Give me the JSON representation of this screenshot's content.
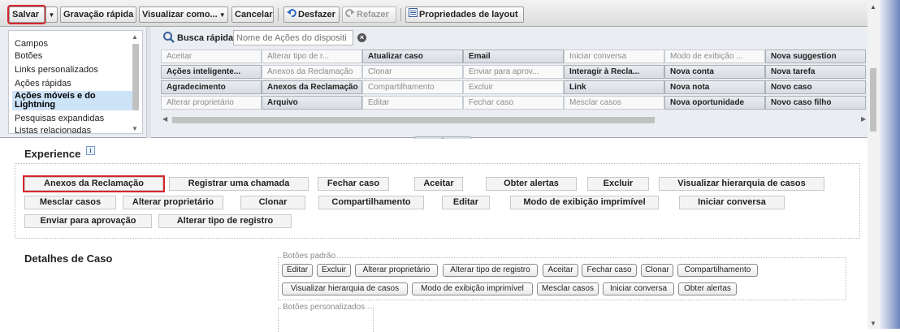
{
  "toolbar": {
    "save": "Salvar",
    "quick_save": "Gravação rápida",
    "view_as": "Visualizar como...",
    "cancel": "Cancelar",
    "undo": "Desfazer",
    "redo": "Refazer",
    "layout_props": "Propriedades de layout"
  },
  "palette": {
    "categories": [
      "Campos",
      "Botões",
      "Links personalizados",
      "Ações rápidas",
      "Ações móveis e do Lightning",
      "Pesquisas expandidas",
      "Listas relacionadas"
    ],
    "selected_category": "Ações móveis e do Lightning",
    "quick_find_label": "Busca rápida",
    "quick_find_placeholder": "Nome de Ações do dispositi",
    "grid": [
      [
        "Aceitar",
        "Alterar tipo de r...",
        "Atualizar caso",
        "Email",
        "Iniciar conversa",
        "Modo de exibição ...",
        "Nova suggestion"
      ],
      [
        "Ações inteligente...",
        "Anexos da Reclamação",
        "Clonar",
        "Enviar para aprov...",
        "Interagir à Recla...",
        "Nova conta",
        "Nova tarefa"
      ],
      [
        "Agradecimento",
        "Anexos da Reclamação",
        "Compartilhamento",
        "Excluir",
        "Link",
        "Nova nota",
        "Novo caso"
      ],
      [
        "Alterar proprietário",
        "Arquivo",
        "Editar",
        "Fechar caso",
        "Mesclar casos",
        "Nova oportunidade",
        "Novo caso filho"
      ]
    ]
  },
  "layout": {
    "experience_title": "Experience",
    "info_glyph": "i",
    "actions": [
      "Anexos da Reclamação",
      "Registrar uma chamada",
      "Fechar caso",
      "Aceitar",
      "Obter alertas",
      "Excluir",
      "Visualizar hierarquia de casos",
      "Mesclar casos",
      "Alterar proprietário",
      "Clonar",
      "Compartilhamento",
      "Editar",
      "Modo de exibição imprimível",
      "Iniciar conversa",
      "Enviar para aprovação",
      "Alterar tipo de registro"
    ],
    "details_title": "Detalhes de Caso",
    "standard_buttons_legend": "Botões padrão",
    "standard_buttons": [
      "Editar",
      "Excluir",
      "Alterar proprietário",
      "Alterar tipo de registro",
      "Aceitar",
      "Fechar caso",
      "Clonar",
      "Compartilhamento",
      "Visualizar hierarquia de casos",
      "Modo de exibição imprimível",
      "Mesclar casos",
      "Iniciar conversa",
      "Obter alertas"
    ],
    "custom_buttons_legend": "Botões personalizados"
  },
  "colors": {
    "highlight_outline": "#d6252e",
    "selected_category_bg": "#cde3f8"
  }
}
